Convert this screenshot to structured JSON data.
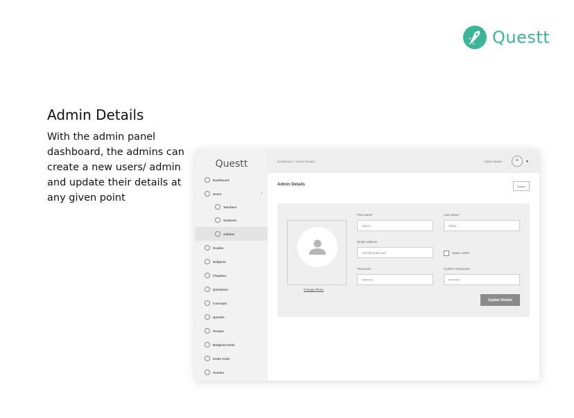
{
  "brand": {
    "name": "Questt",
    "color": "#3bb596",
    "icon": "rocket-icon"
  },
  "headline": "Admin Details",
  "description": "With the admin panel dashboard, the admins can create a new users/ admin and update their details at any given point",
  "mockup": {
    "logo": "Questt",
    "sidebar": {
      "items": [
        {
          "label": "Dashboard"
        },
        {
          "label": "Users"
        },
        {
          "label": "Teachers"
        },
        {
          "label": "Students"
        },
        {
          "label": "Admins"
        },
        {
          "label": "Grades"
        },
        {
          "label": "Subjects"
        },
        {
          "label": "Chapters"
        },
        {
          "label": "Questions"
        },
        {
          "label": "Concepts"
        },
        {
          "label": "Questts"
        },
        {
          "label": "Groups"
        },
        {
          "label": "Badges/Levels"
        },
        {
          "label": "Invite Code"
        },
        {
          "label": "Avatars"
        }
      ]
    },
    "topbar": {
      "breadcrumb": "Dashboard > Admin Details",
      "admin_name": "Admin Name"
    },
    "page_title": "Admin Details",
    "delete_label": "Delete",
    "form": {
      "change_photo": "Change Photo",
      "first_name_label": "First name*",
      "first_name_value": "Janice",
      "last_name_label": "Last name*",
      "last_name_value": "Oliver",
      "email_label": "Email Address",
      "email_value": "John@email.com",
      "super_admin_label": "Super Admin",
      "password_label": "Password",
      "password_value": "••••••••••",
      "confirm_label": "Confirm Password",
      "confirm_value": "••••••••••",
      "update_label": "Update Details"
    }
  }
}
